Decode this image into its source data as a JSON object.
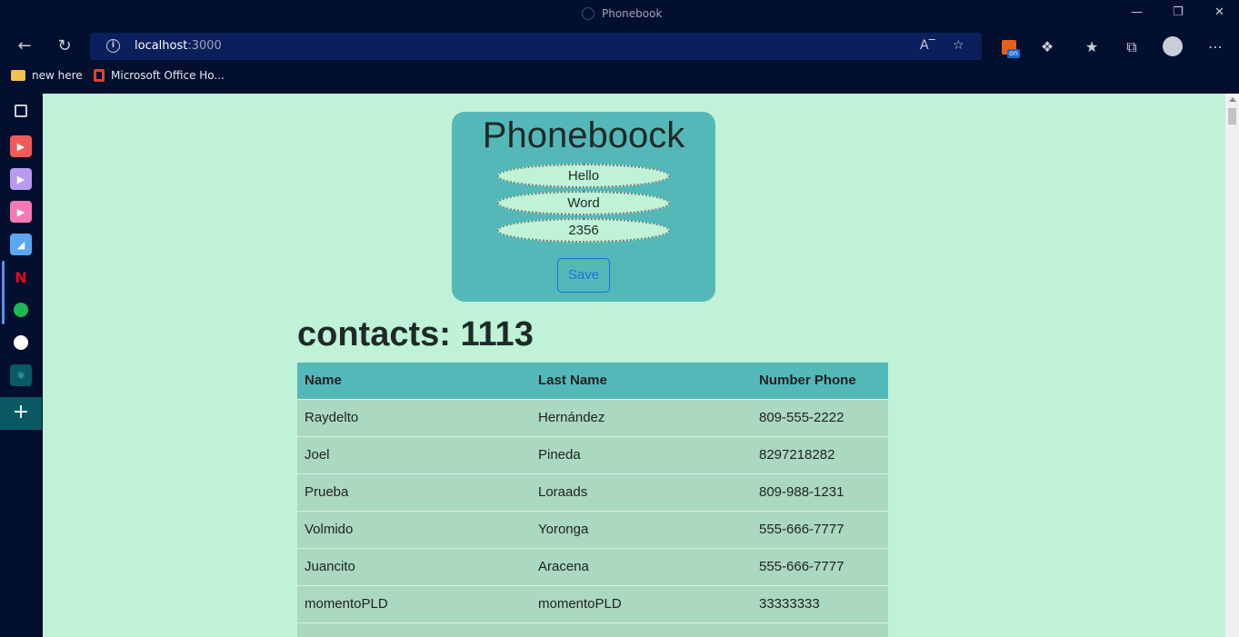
{
  "window": {
    "title": "Phonebook"
  },
  "browser": {
    "url_host": "localhost",
    "url_port": ":3000",
    "favorites": [
      {
        "label": "new here",
        "icon": "folder-icon"
      },
      {
        "label": "Microsoft Office Ho...",
        "icon": "office-icon"
      }
    ],
    "extension_badge": "on"
  },
  "form": {
    "heading": "Phoneboock",
    "first_name_value": "Hello",
    "last_name_value": "Word",
    "phone_value": "2356",
    "save_label": "Save"
  },
  "contacts_heading": "contacts: 1113",
  "table": {
    "headers": [
      "Name",
      "Last Name",
      "Number Phone"
    ],
    "rows": [
      [
        "Raydelto",
        "Hernández",
        "809-555-2222"
      ],
      [
        "Joel",
        "Pineda",
        "8297218282"
      ],
      [
        "Prueba",
        "Loraads",
        "809-988-1231"
      ],
      [
        "Volmido",
        "Yoronga",
        "555-666-7777"
      ],
      [
        "Juancito",
        "Aracena",
        "555-666-7777"
      ],
      [
        "momentoPLD",
        "momentoPLD",
        "33333333"
      ]
    ]
  },
  "colors": {
    "page_bg": "#bff2d6",
    "card_bg": "#55b8b8",
    "row_bg": "#aad8c0",
    "accent": "#1f6fe0"
  }
}
